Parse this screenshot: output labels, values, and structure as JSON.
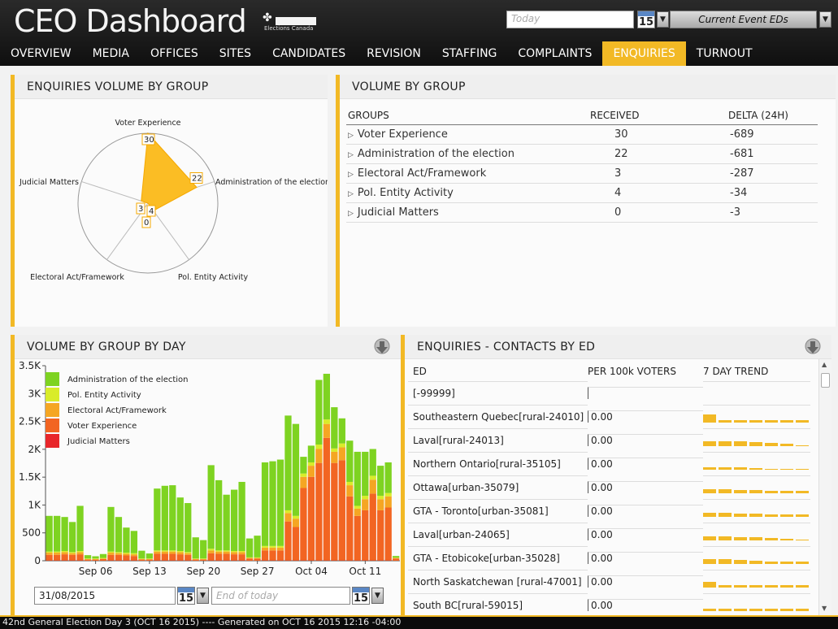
{
  "header": {
    "title": "CEO Dashboard",
    "logo_text": "Elections Canada",
    "date_placeholder": "Today",
    "calendar_day": "15",
    "event_select": "Current Event EDs"
  },
  "nav": {
    "tabs": [
      "OVERVIEW",
      "MEDIA",
      "OFFICES",
      "SITES",
      "CANDIDATES",
      "REVISION",
      "STAFFING",
      "COMPLAINTS",
      "ENQUIRIES",
      "TURNOUT"
    ],
    "active": "ENQUIRIES"
  },
  "colors": {
    "accent": "#f2b925",
    "admin": "#7ed321",
    "pol": "#d9ec2a",
    "electoral": "#f5a623",
    "voter": "#f26522",
    "judicial": "#e8262a"
  },
  "radar": {
    "title": "ENQUIRIES VOLUME BY GROUP",
    "axes": [
      "Voter Experience",
      "Administration of the election",
      "Pol. Entity Activity",
      "Electoral Act/Framework",
      "Judicial Matters"
    ],
    "values": [
      30,
      22,
      4,
      0,
      3
    ],
    "max": 30
  },
  "volume_by_group": {
    "title": "VOLUME BY GROUP",
    "columns": [
      "GROUPS",
      "RECEIVED",
      "DELTA (24H)"
    ],
    "rows": [
      {
        "group": "Voter Experience",
        "received": "30",
        "delta": "-689"
      },
      {
        "group": "Administration of the election",
        "received": "22",
        "delta": "-681"
      },
      {
        "group": "Electoral Act/Framework",
        "received": "3",
        "delta": "-287"
      },
      {
        "group": "Pol. Entity Activity",
        "received": "4",
        "delta": "-34"
      },
      {
        "group": "Judicial Matters",
        "received": "0",
        "delta": "-3"
      }
    ]
  },
  "chart_data": {
    "type": "bar",
    "stacked": true,
    "title": "VOLUME BY GROUP BY DAY",
    "x_tick_labels": [
      "Sep 06",
      "Sep 13",
      "Sep 20",
      "Sep 27",
      "Oct 04",
      "Oct 11"
    ],
    "y_tick_labels": [
      "0",
      "500",
      "1K",
      "1.5K",
      "2K",
      "2.5K",
      "3K",
      "3.5K"
    ],
    "ylim": [
      0,
      3500
    ],
    "legend_position": "top-left",
    "series_order": [
      "Administration of the election",
      "Pol. Entity Activity",
      "Electoral Act/Framework",
      "Voter Experience",
      "Judicial Matters"
    ],
    "days": [
      {
        "date": "2015-08-31",
        "voter": 100,
        "electoral": 40,
        "pol": 20,
        "admin": 640,
        "judicial": 5
      },
      {
        "date": "2015-09-01",
        "voter": 100,
        "electoral": 40,
        "pol": 20,
        "admin": 640,
        "judicial": 5
      },
      {
        "date": "2015-09-02",
        "voter": 110,
        "electoral": 40,
        "pol": 20,
        "admin": 610,
        "judicial": 5
      },
      {
        "date": "2015-09-03",
        "voter": 100,
        "electoral": 30,
        "pol": 20,
        "admin": 540,
        "judicial": 5
      },
      {
        "date": "2015-09-04",
        "voter": 110,
        "electoral": 40,
        "pol": 20,
        "admin": 810,
        "judicial": 5
      },
      {
        "date": "2015-09-05",
        "voter": 20,
        "electoral": 10,
        "pol": 10,
        "admin": 60,
        "judicial": 0
      },
      {
        "date": "2015-09-06",
        "voter": 20,
        "electoral": 10,
        "pol": 10,
        "admin": 40,
        "judicial": 0
      },
      {
        "date": "2015-09-07",
        "voter": 30,
        "electoral": 10,
        "pol": 10,
        "admin": 70,
        "judicial": 0
      },
      {
        "date": "2015-09-08",
        "voter": 100,
        "electoral": 40,
        "pol": 20,
        "admin": 800,
        "judicial": 5
      },
      {
        "date": "2015-09-09",
        "voter": 100,
        "electoral": 30,
        "pol": 20,
        "admin": 630,
        "judicial": 5
      },
      {
        "date": "2015-09-10",
        "voter": 90,
        "electoral": 30,
        "pol": 20,
        "admin": 450,
        "judicial": 5
      },
      {
        "date": "2015-09-11",
        "voter": 80,
        "electoral": 30,
        "pol": 20,
        "admin": 400,
        "judicial": 5
      },
      {
        "date": "2015-09-12",
        "voter": 20,
        "electoral": 10,
        "pol": 10,
        "admin": 140,
        "judicial": 0
      },
      {
        "date": "2015-09-13",
        "voter": 20,
        "electoral": 10,
        "pol": 10,
        "admin": 90,
        "judicial": 0
      },
      {
        "date": "2015-09-14",
        "voter": 120,
        "electoral": 40,
        "pol": 20,
        "admin": 1110,
        "judicial": 5
      },
      {
        "date": "2015-09-15",
        "voter": 120,
        "electoral": 40,
        "pol": 20,
        "admin": 1160,
        "judicial": 5
      },
      {
        "date": "2015-09-16",
        "voter": 120,
        "electoral": 40,
        "pol": 20,
        "admin": 1170,
        "judicial": 5
      },
      {
        "date": "2015-09-17",
        "voter": 110,
        "electoral": 40,
        "pol": 20,
        "admin": 960,
        "judicial": 5
      },
      {
        "date": "2015-09-18",
        "voter": 100,
        "electoral": 30,
        "pol": 20,
        "admin": 880,
        "judicial": 5
      },
      {
        "date": "2015-09-19",
        "voter": 20,
        "electoral": 10,
        "pol": 10,
        "admin": 380,
        "judicial": 0
      },
      {
        "date": "2015-09-20",
        "voter": 20,
        "electoral": 10,
        "pol": 10,
        "admin": 330,
        "judicial": 0
      },
      {
        "date": "2015-09-21",
        "voter": 130,
        "electoral": 50,
        "pol": 30,
        "admin": 1500,
        "judicial": 5
      },
      {
        "date": "2015-09-22",
        "voter": 120,
        "electoral": 40,
        "pol": 20,
        "admin": 1260,
        "judicial": 5
      },
      {
        "date": "2015-09-23",
        "voter": 120,
        "electoral": 40,
        "pol": 20,
        "admin": 1000,
        "judicial": 5
      },
      {
        "date": "2015-09-24",
        "voter": 110,
        "electoral": 40,
        "pol": 20,
        "admin": 1100,
        "judicial": 5
      },
      {
        "date": "2015-09-25",
        "voter": 110,
        "electoral": 40,
        "pol": 20,
        "admin": 1240,
        "judicial": 5
      },
      {
        "date": "2015-09-26",
        "voter": 40,
        "electoral": 10,
        "pol": 10,
        "admin": 340,
        "judicial": 0
      },
      {
        "date": "2015-09-27",
        "voter": 40,
        "electoral": 10,
        "pol": 10,
        "admin": 390,
        "judicial": 0
      },
      {
        "date": "2015-09-28",
        "voter": 180,
        "electoral": 50,
        "pol": 30,
        "admin": 1500,
        "judicial": 5
      },
      {
        "date": "2015-09-29",
        "voter": 180,
        "electoral": 50,
        "pol": 30,
        "admin": 1520,
        "judicial": 5
      },
      {
        "date": "2015-09-30",
        "voter": 180,
        "electoral": 50,
        "pol": 30,
        "admin": 1550,
        "judicial": 5
      },
      {
        "date": "2015-10-01",
        "voter": 700,
        "electoral": 150,
        "pol": 50,
        "admin": 1700,
        "judicial": 5
      },
      {
        "date": "2015-10-02",
        "voter": 600,
        "electoral": 150,
        "pol": 50,
        "admin": 1650,
        "judicial": 5
      },
      {
        "date": "2015-10-03",
        "voter": 1300,
        "electoral": 200,
        "pol": 60,
        "admin": 300,
        "judicial": 5
      },
      {
        "date": "2015-10-04",
        "voter": 1500,
        "electoral": 200,
        "pol": 60,
        "admin": 300,
        "judicial": 5
      },
      {
        "date": "2015-10-05",
        "voter": 1750,
        "electoral": 250,
        "pol": 80,
        "admin": 1160,
        "judicial": 5
      },
      {
        "date": "2015-10-06",
        "voter": 2200,
        "electoral": 250,
        "pol": 80,
        "admin": 820,
        "judicial": 5
      },
      {
        "date": "2015-10-07",
        "voter": 1750,
        "electoral": 200,
        "pol": 60,
        "admin": 740,
        "judicial": 5
      },
      {
        "date": "2015-10-08",
        "voter": 1800,
        "electoral": 230,
        "pol": 70,
        "admin": 450,
        "judicial": 5
      },
      {
        "date": "2015-10-09",
        "voter": 1150,
        "electoral": 200,
        "pol": 60,
        "admin": 740,
        "judicial": 5
      },
      {
        "date": "2015-10-10",
        "voter": 800,
        "electoral": 130,
        "pol": 50,
        "admin": 970,
        "judicial": 5
      },
      {
        "date": "2015-10-11",
        "voter": 900,
        "electoral": 200,
        "pol": 60,
        "admin": 790,
        "judicial": 5
      },
      {
        "date": "2015-10-12",
        "voter": 1200,
        "electoral": 250,
        "pol": 70,
        "admin": 480,
        "judicial": 5
      },
      {
        "date": "2015-10-13",
        "voter": 900,
        "electoral": 200,
        "pol": 60,
        "admin": 540,
        "judicial": 5
      },
      {
        "date": "2015-10-14",
        "voter": 950,
        "electoral": 200,
        "pol": 60,
        "admin": 550,
        "judicial": 5
      },
      {
        "date": "2015-10-15",
        "voter": 40,
        "electoral": 10,
        "pol": 5,
        "admin": 30,
        "judicial": 0
      }
    ]
  },
  "day_chart": {
    "from_date": "31/08/2015",
    "to_placeholder": "End of today",
    "calendar_day": "15"
  },
  "contacts": {
    "title": "ENQUIRIES - CONTACTS BY ED",
    "columns": [
      "ED",
      "PER 100k VOTERS",
      "7 DAY TREND"
    ],
    "rows": [
      {
        "ed": "[-99999]",
        "per100k": "",
        "trend": []
      },
      {
        "ed": "Southeastern Quebec[rural-24010]",
        "per100k": "0.00",
        "trend": [
          1.0,
          0.3,
          0.3,
          0.3,
          0.3,
          0.3,
          0.3
        ]
      },
      {
        "ed": "Laval[rural-24013]",
        "per100k": "0.00",
        "trend": [
          0.6,
          0.6,
          0.6,
          0.5,
          0.4,
          0.3,
          0
        ]
      },
      {
        "ed": "Northern Ontario[rural-35105]",
        "per100k": "0.00",
        "trend": [
          0.3,
          0.3,
          0.3,
          0.2,
          0,
          0,
          0
        ]
      },
      {
        "ed": "Ottawa[urban-35079]",
        "per100k": "0.00",
        "trend": [
          0.5,
          0.5,
          0.4,
          0.4,
          0.3,
          0.3,
          0.3
        ]
      },
      {
        "ed": "GTA - Toronto[urban-35081]",
        "per100k": "0.00",
        "trend": [
          0.5,
          0.5,
          0.4,
          0.4,
          0.3,
          0.3,
          0.3
        ]
      },
      {
        "ed": "Laval[urban-24065]",
        "per100k": "0.00",
        "trend": [
          0.5,
          0.5,
          0.4,
          0.4,
          0.3,
          0.2,
          0.1
        ]
      },
      {
        "ed": "GTA - Etobicoke[urban-35028]",
        "per100k": "0.00",
        "trend": [
          0.6,
          0.6,
          0.5,
          0.4,
          0.3,
          0.3,
          0.3
        ]
      },
      {
        "ed": "North Saskatchewan [rural-47001]",
        "per100k": "0.00",
        "trend": [
          0.7,
          0.3,
          0.3,
          0.3,
          0.3,
          0.3,
          0.3
        ]
      },
      {
        "ed": "South BC[rural-59015]",
        "per100k": "0.00",
        "trend": [
          0.3,
          0.3,
          0.3,
          0.3,
          0.3,
          0.3,
          0.3
        ]
      }
    ]
  },
  "footer": "42nd General Election Day 3 (OCT 16 2015) ---- Generated on OCT 16 2015 12:16 -04:00"
}
